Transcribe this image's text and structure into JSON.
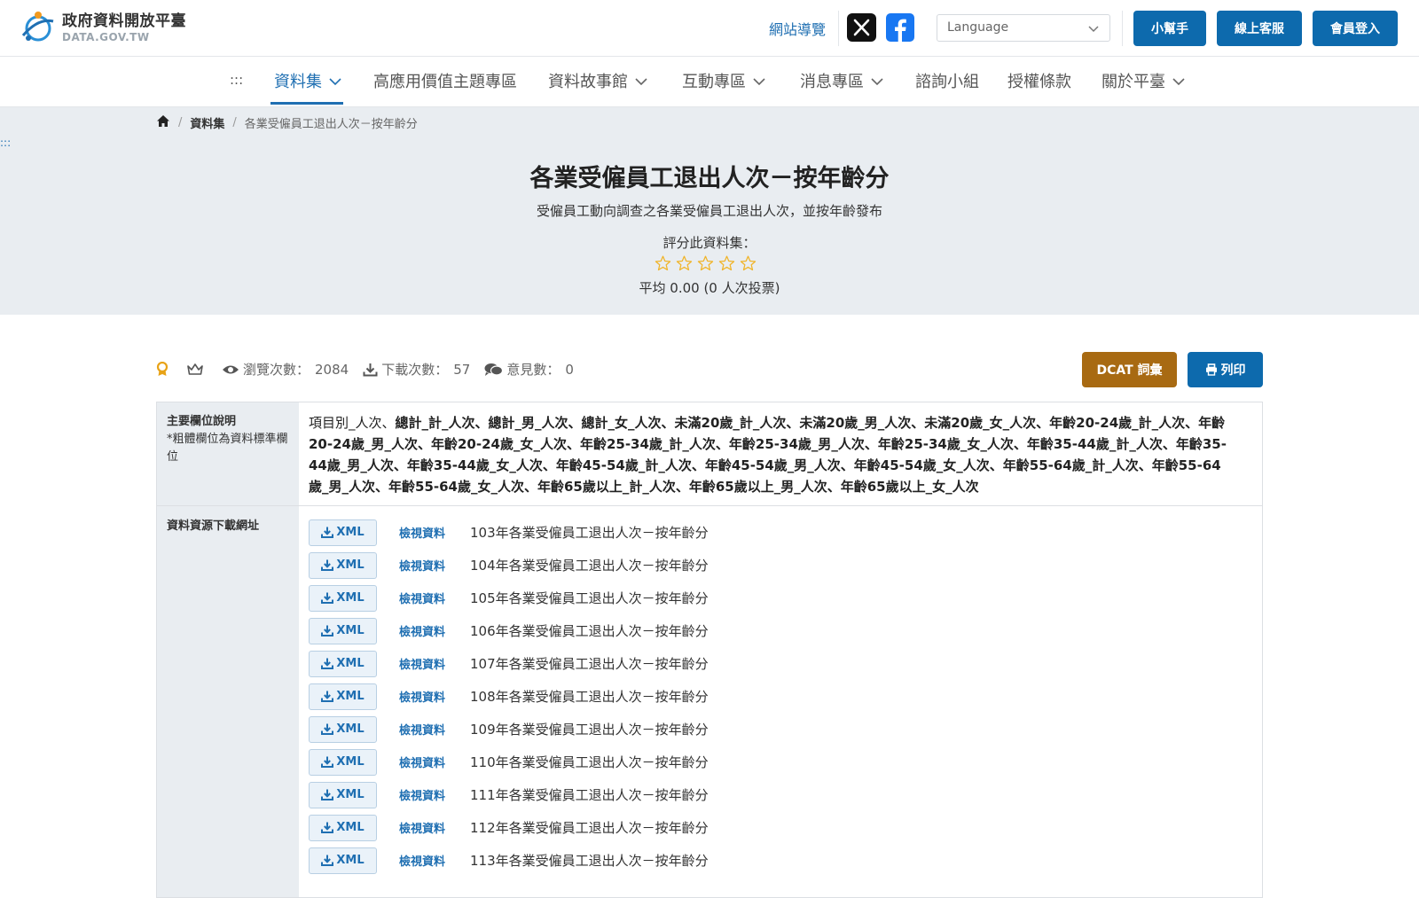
{
  "header": {
    "logo_title": "政府資料開放平臺",
    "logo_sub": "DATA.GOV.TW",
    "nav_guide": "網站導覽",
    "language_placeholder": "Language",
    "btn_helper": "小幫手",
    "btn_service": "線上客服",
    "btn_login": "會員登入"
  },
  "nav": {
    "skip": ":::",
    "items": [
      {
        "label": "資料集",
        "dropdown": true
      },
      {
        "label": "高應用價值主題專區",
        "dropdown": false
      },
      {
        "label": "資料故事館",
        "dropdown": true
      },
      {
        "label": "互動專區",
        "dropdown": true
      },
      {
        "label": "消息專區",
        "dropdown": true
      },
      {
        "label": "諮詢小組",
        "dropdown": false
      },
      {
        "label": "授權條款",
        "dropdown": false
      },
      {
        "label": "關於平臺",
        "dropdown": true
      }
    ]
  },
  "breadcrumb": {
    "sep": "/",
    "level1": "資料集",
    "level2": "各業受僱員工退出人次－按年齡分"
  },
  "hero": {
    "skip": ":::",
    "title": "各業受僱員工退出人次－按年齡分",
    "subtitle": "受僱員工動向調查之各業受僱員工退出人次，並按年齡發布",
    "rate_label": "評分此資料集：",
    "avg": "平均 0.00 (0 人次投票)",
    "star_color": "#f0b429"
  },
  "stats": {
    "views_label": "瀏覽次數：",
    "views": "2084",
    "downloads_label": "下載次數：",
    "downloads": "57",
    "comments_label": "意見數：",
    "comments": "0"
  },
  "actions": {
    "dcat": "DCAT 詞彙",
    "print": "列印"
  },
  "fields_section": {
    "label_title": "主要欄位說明",
    "label_note": "*粗體欄位為資料標準欄位",
    "first_field": "項目別_人次",
    "sep": "、",
    "bold_fields": "總計_計_人次、總計_男_人次、總計_女_人次、未滿20歲_計_人次、未滿20歲_男_人次、未滿20歲_女_人次、年齡20-24歲_計_人次、年齡20-24歲_男_人次、年齡20-24歲_女_人次、年齡25-34歲_計_人次、年齡25-34歲_男_人次、年齡25-34歲_女_人次、年齡35-44歲_計_人次、年齡35-44歲_男_人次、年齡35-44歲_女_人次、年齡45-54歲_計_人次、年齡45-54歲_男_人次、年齡45-54歲_女_人次、年齡55-64歲_計_人次、年齡55-64歲_男_人次、年齡55-64歲_女_人次、年齡65歲以上_計_人次、年齡65歲以上_男_人次、年齡65歲以上_女_人次"
  },
  "resources": {
    "label": "資料資源下載網址",
    "xml_label": "XML",
    "view_label": "檢視資料",
    "items": [
      "103年各業受僱員工退出人次－按年齡分",
      "104年各業受僱員工退出人次－按年齡分",
      "105年各業受僱員工退出人次－按年齡分",
      "106年各業受僱員工退出人次－按年齡分",
      "107年各業受僱員工退出人次－按年齡分",
      "108年各業受僱員工退出人次－按年齡分",
      "109年各業受僱員工退出人次－按年齡分",
      "110年各業受僱員工退出人次－按年齡分",
      "111年各業受僱員工退出人次－按年齡分",
      "112年各業受僱員工退出人次－按年齡分",
      "113年各業受僱員工退出人次－按年齡分"
    ]
  },
  "colors": {
    "primary": "#0d6aad",
    "link": "#1f6fb2",
    "dcat": "#a86a12",
    "hero_bg": "#e9edf1"
  }
}
